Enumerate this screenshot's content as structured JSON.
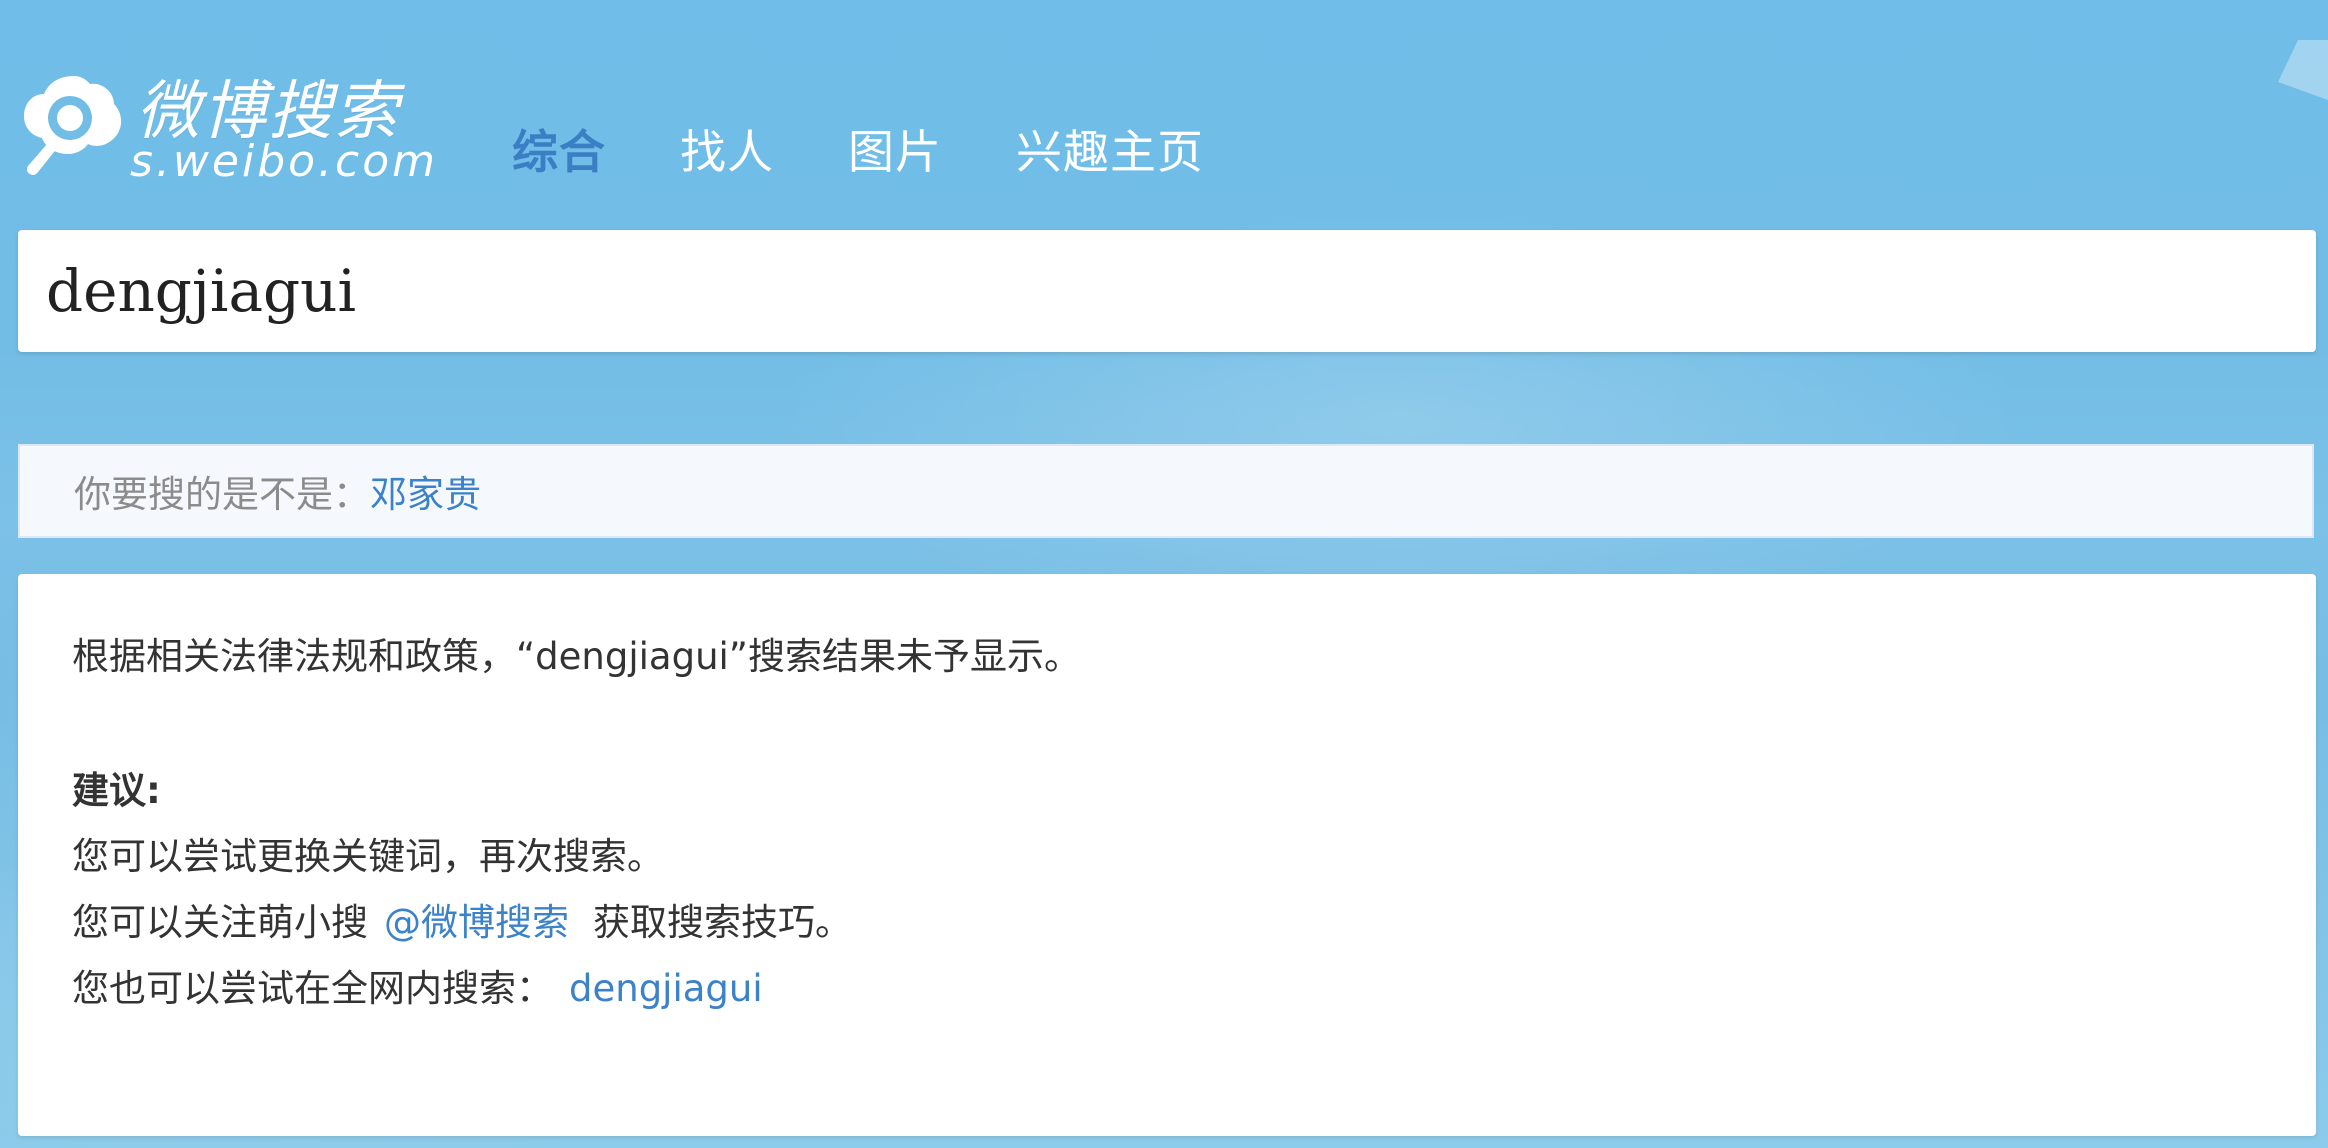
{
  "logo": {
    "title": "微博搜索",
    "domain": "s.weibo.com"
  },
  "nav": {
    "tabs": [
      {
        "label": "综合",
        "active": true
      },
      {
        "label": "找人",
        "active": false
      },
      {
        "label": "图片",
        "active": false
      },
      {
        "label": "兴趣主页",
        "active": false
      }
    ]
  },
  "search": {
    "query": "dengjiagui"
  },
  "suggestion": {
    "prefix": "你要搜的是不是：",
    "link": "邓家贵"
  },
  "result": {
    "notice": "根据相关法律法规和政策，“dengjiagui”搜索结果未予显示。",
    "advice_title": "建议:",
    "line1": "您可以尝试更换关键词，再次搜索。",
    "line2_prefix": "您可以关注萌小搜",
    "line2_link": "@微博搜索",
    "line2_suffix": "获取搜索技巧。",
    "line3_prefix": "您也可以尝试在全网内搜索：",
    "line3_link": "dengjiagui"
  },
  "colors": {
    "background": "#72bde6",
    "active_tab": "#3a7fc4",
    "link": "#3b82c9",
    "text": "#333333",
    "muted_text": "#8b8b8b"
  },
  "icons": {
    "logo": "magnifier-cloud-icon"
  }
}
